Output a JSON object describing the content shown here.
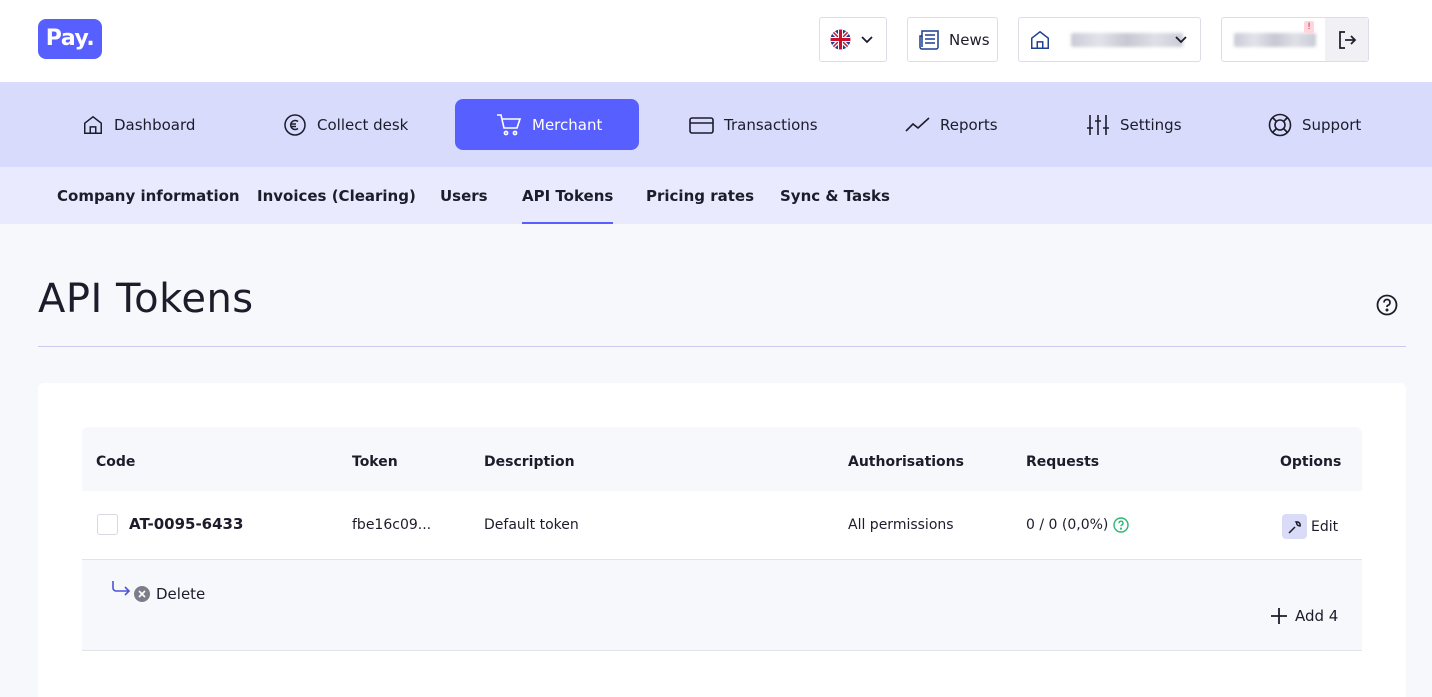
{
  "header": {
    "logo_text": "Pay.",
    "news_label": "News",
    "notification_badge": "!",
    "language_flag": "uk-flag-icon"
  },
  "nav": {
    "items": [
      {
        "label": "Dashboard",
        "icon": "home-icon"
      },
      {
        "label": "Collect desk",
        "icon": "euro-icon"
      },
      {
        "label": "Merchant",
        "icon": "cart-icon"
      },
      {
        "label": "Transactions",
        "icon": "card-icon"
      },
      {
        "label": "Reports",
        "icon": "chart-line-icon"
      },
      {
        "label": "Settings",
        "icon": "sliders-icon"
      },
      {
        "label": "Support",
        "icon": "lifebuoy-icon"
      }
    ],
    "active": "Merchant"
  },
  "subnav": {
    "items": [
      {
        "label": "Company information"
      },
      {
        "label": "Invoices (Clearing)"
      },
      {
        "label": "Users"
      },
      {
        "label": "API Tokens"
      },
      {
        "label": "Pricing rates"
      },
      {
        "label": "Sync & Tasks"
      }
    ],
    "active": "API Tokens"
  },
  "page": {
    "title": "API Tokens"
  },
  "table": {
    "columns": {
      "code": "Code",
      "token": "Token",
      "description": "Description",
      "authorisations": "Authorisations",
      "requests": "Requests",
      "options": "Options"
    },
    "rows": [
      {
        "code": "AT-0095-6433",
        "token": "fbe16c09...",
        "description": "Default token",
        "authorisations": "All permissions",
        "requests": "0 / 0 (0,0%)",
        "edit_label": "Edit"
      }
    ],
    "delete_label": "Delete",
    "add_label": "Add 4"
  },
  "colors": {
    "accent": "#585fff",
    "nav_bg": "#d9dbfc",
    "subnav_bg": "#e9eafd",
    "success": "#2bb673"
  }
}
